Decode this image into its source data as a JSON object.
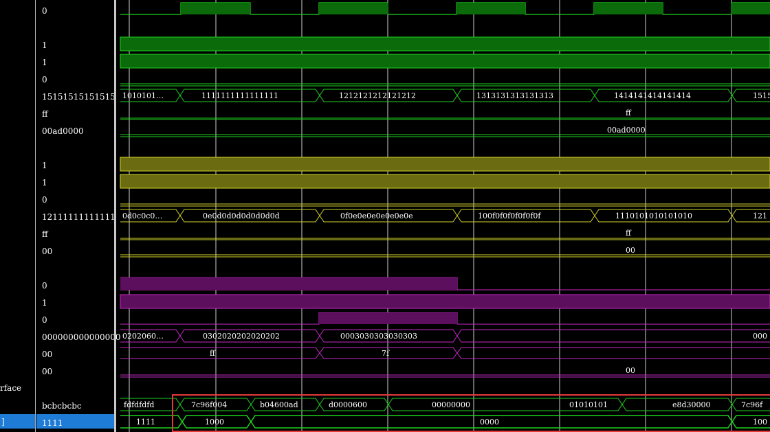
{
  "name_column": {
    "partial_label": "rface",
    "selected_partial_label": "]"
  },
  "values": [
    "0",
    "1",
    "1",
    "0",
    "15151515151515",
    "ff",
    "00ad0000",
    "1",
    "1",
    "0",
    "12111111111111",
    "ff",
    "00",
    "0",
    "1",
    "0",
    "000000000000000",
    "00",
    "00",
    "bcbcbcbc",
    "1111"
  ],
  "colors": {
    "green": "#1fd21f",
    "green_fill": "#0b6b0b",
    "yellow": "#d3d32a",
    "yellow_fill": "#6b6b12",
    "magenta": "#c62ac6",
    "magenta_fill": "#5c0f5c",
    "selection": "#1e7bd6",
    "highlight_box": "#e53a3a",
    "cursor_lines": "#d0d0d0"
  },
  "bus_labels": {
    "green_data": [
      "1010101…",
      "1111111111111111",
      "1212121212121212",
      "1313131313131313",
      "1414141414141414",
      "1515"
    ],
    "green_ff": "ff",
    "green_addr": "00ad0000",
    "yellow_data": [
      "0d0c0c0…",
      "0e0d0d0d0d0d0d0d",
      "0f0e0e0e0e0e0e0e",
      "100f0f0f0f0f0f0f",
      "1110101010101010",
      "121"
    ],
    "yellow_ff": "ff",
    "yellow_00": "00",
    "magenta_data": [
      "0202060…",
      "0302020202020202",
      "0003030303030303",
      "000"
    ],
    "magenta_ff": [
      "ff",
      "7f"
    ],
    "magenta_00": "00",
    "bottom_data": [
      "fdfdfdfd",
      "7c96f004",
      "b04600ad",
      "d0000600",
      "00000000",
      "01010101",
      "e8d30000",
      "7c96f"
    ],
    "bottom_sel": [
      "1111",
      "1000",
      "0000",
      "100"
    ]
  }
}
